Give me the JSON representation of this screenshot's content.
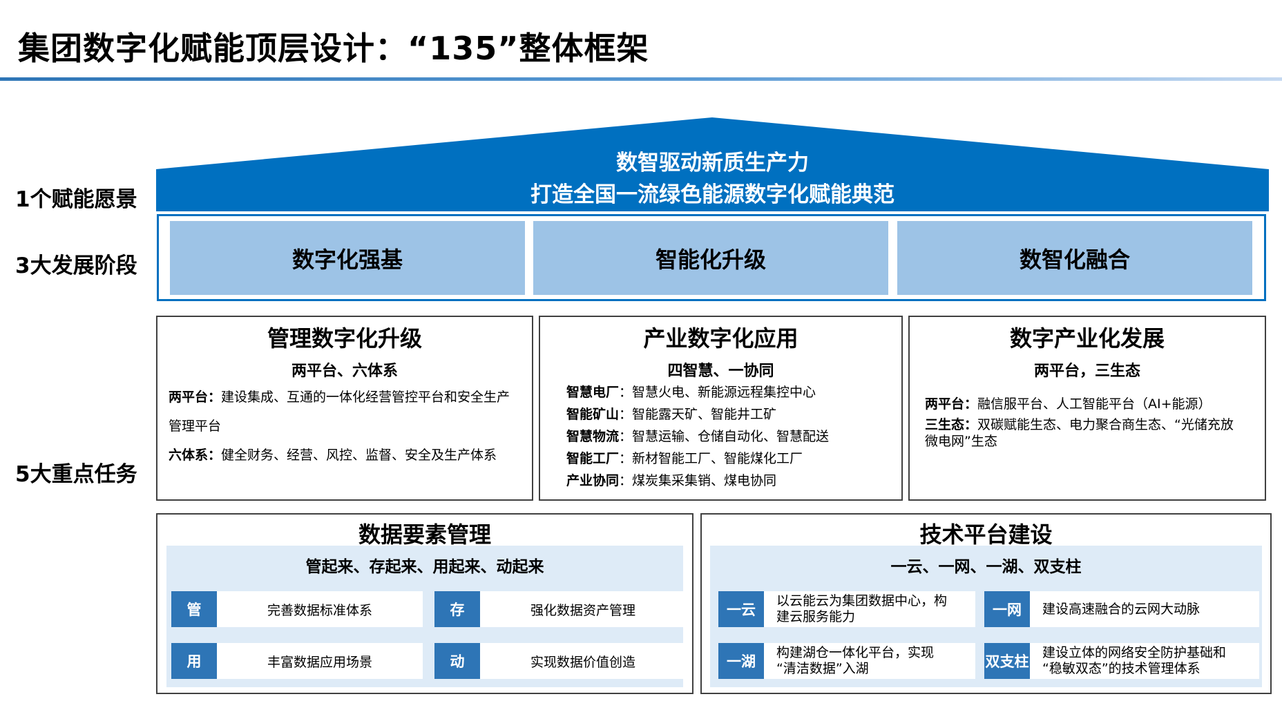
{
  "title": "集团数字化赋能顶层设计：“135”整体框架",
  "side_labels": {
    "vision": "1个赋能愿景",
    "stages": "3大发展阶段",
    "tasks": "5大重点任务"
  },
  "vision": {
    "line1": "数智驱动新质生产力",
    "line2": "打造全国一流绿色能源数字化赋能典范"
  },
  "stages": [
    "数字化强基",
    "智能化升级",
    "数智化融合"
  ],
  "tasks": [
    {
      "title": "管理数字化升级",
      "subtitle": "两平台、六体系",
      "lines": [
        {
          "key": "两平台：",
          "text": "建设集成、互通的一体化经营管控平台和安全生产"
        },
        {
          "key": "",
          "text": "管理平台"
        },
        {
          "key": "六体系：",
          "text": "健全财务、经营、风控、监督、安全及生产体系"
        }
      ]
    },
    {
      "title": "产业数字化应用",
      "subtitle": "四智慧、一协同",
      "lines": [
        {
          "key": "智慧电厂",
          "text": "：智慧火电、新能源远程集控中心"
        },
        {
          "key": "智能矿山",
          "text": "：智能露天矿、智能井工矿"
        },
        {
          "key": "智慧物流",
          "text": "：智慧运输、仓储自动化、智慧配送"
        },
        {
          "key": "智能工厂",
          "text": "：新材智能工厂、智能煤化工厂"
        },
        {
          "key": "产业协同",
          "text": "：煤炭集采集销、煤电协同"
        }
      ]
    },
    {
      "title": "数字产业化发展",
      "subtitle": "两平台，三生态",
      "lines": [
        {
          "key": "两平台：",
          "text": "融信服平台、人工智能平台（AI+能源）"
        },
        {
          "key": "三生态：",
          "text": "双碳赋能生态、电力聚合商生态、“光储充放"
        },
        {
          "key": "",
          "text": "微电网”生态"
        }
      ]
    }
  ],
  "data_mgmt": {
    "title": "数据要素管理",
    "subtitle": "管起来、存起来、用起来、动起来",
    "cards": [
      {
        "badge": "管",
        "text": "完善数据标准体系"
      },
      {
        "badge": "存",
        "text": "强化数据资产管理"
      },
      {
        "badge": "用",
        "text": "丰富数据应用场景"
      },
      {
        "badge": "动",
        "text": "实现数据价值创造"
      }
    ]
  },
  "tech_platform": {
    "title": "技术平台建设",
    "subtitle": "一云、一网、一湖、双支柱",
    "cards": [
      {
        "badge": "一云",
        "text1": "以云能云为集团数据中心，构",
        "text2": "建云服务能力"
      },
      {
        "badge": "一网",
        "text1": "建设高速融合的云网大动脉",
        "text2": ""
      },
      {
        "badge": "一湖",
        "text1": "构建湖仓一体化平台，实现",
        "text2": "“清洁数据”入湖"
      },
      {
        "badge": "双支柱",
        "text1": "建设立体的网络安全防护基础和",
        "text2": "“稳敏双态”的技术管理体系"
      }
    ]
  },
  "colors": {
    "roof": "#0070c0",
    "stage_fill": "#9dc3e6",
    "badge": "#2e75b6",
    "panel": "#deebf7"
  }
}
